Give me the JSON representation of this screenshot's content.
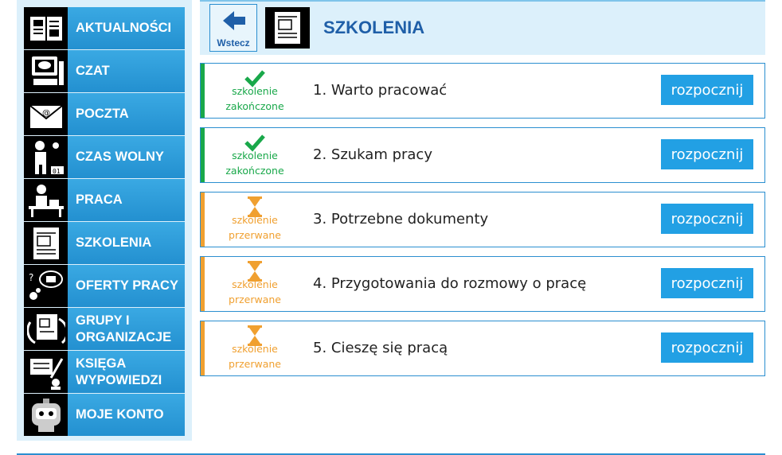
{
  "sidebar": {
    "items": [
      {
        "label": "AKTUALNOŚCI",
        "icon": "newspaper-icon"
      },
      {
        "label": "CZAT",
        "icon": "computer-chat-icon"
      },
      {
        "label": "POCZTA",
        "icon": "envelope-icon"
      },
      {
        "label": "CZAS WOLNY",
        "icon": "leisure-icon"
      },
      {
        "label": "PRACA",
        "icon": "worker-desk-icon"
      },
      {
        "label": "SZKOLENIA",
        "icon": "document-icon"
      },
      {
        "label": "OFERTY PRACY",
        "icon": "thinking-icon"
      },
      {
        "label": "GRUPY I\nORGANIZACJE",
        "icon": "groups-icon"
      },
      {
        "label": "KSIĘGA\nWYPOWIEDZI",
        "icon": "guestbook-icon"
      },
      {
        "label": "MOJE KONTO",
        "icon": "robot-icon"
      }
    ]
  },
  "header": {
    "back_label": "Wstecz",
    "title": "SZKOLENIA"
  },
  "courses": [
    {
      "title": "1. Warto pracować",
      "status_line1": "szkolenie",
      "status_line2": "zakończone",
      "status": "completed",
      "button": "rozpocznij"
    },
    {
      "title": "2. Szukam pracy",
      "status_line1": "szkolenie",
      "status_line2": "zakończone",
      "status": "completed",
      "button": "rozpocznij"
    },
    {
      "title": "3. Potrzebne dokumenty",
      "status_line1": "szkolenie",
      "status_line2": "przerwane",
      "status": "interrupted",
      "button": "rozpocznij"
    },
    {
      "title": "4. Przygotowania do rozmowy o pracę",
      "status_line1": "szkolenie",
      "status_line2": "przerwane",
      "status": "interrupted",
      "button": "rozpocznij"
    },
    {
      "title": "5. Cieszę się pracą",
      "status_line1": "szkolenie",
      "status_line2": "przerwane",
      "status": "interrupted",
      "button": "rozpocznij"
    }
  ],
  "colors": {
    "completed": "#19a84a",
    "interrupted": "#f0a030",
    "accent": "#22a0e4",
    "title": "#1f5fa8"
  }
}
